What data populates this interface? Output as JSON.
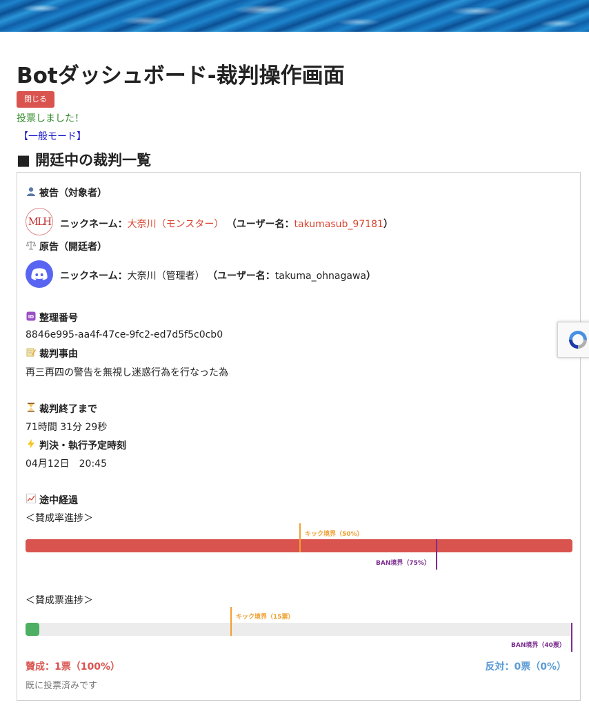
{
  "header": {
    "title": "Botダッシュボード-裁判操作画面"
  },
  "actions": {
    "close_label": "閉じる"
  },
  "status": {
    "vote_message": "投票しました！",
    "mode_label": "【一般モード】"
  },
  "section": {
    "title": "■ 開廷中の裁判一覧"
  },
  "trial": {
    "defendant": {
      "heading": "被告（対象者）",
      "avatar_text": "MLH",
      "nickname_label": "ニックネーム：",
      "nickname": "大奈川（モンスター）",
      "username_label": "（ユーザー名：",
      "username": "takumasub_97181",
      "username_close": "）"
    },
    "plaintiff": {
      "heading": "原告（開廷者）",
      "nickname_label": "ニックネーム：",
      "nickname": "大奈川（管理者）",
      "username_label": "（ユーザー名：",
      "username": "takuma_ohnagawa",
      "username_close": "）"
    },
    "id": {
      "heading": "整理番号",
      "value": "8846e995-aa4f-47ce-9fc2-ed7d5f5c0cb0"
    },
    "reason": {
      "heading": "裁判事由",
      "value": "再三再四の警告を無視し迷惑行為を行なった為"
    },
    "remaining": {
      "heading": "裁判終了まで",
      "value": "71時間 31分 29秒"
    },
    "verdict": {
      "heading": "判決・執行予定時刻",
      "value": "04月12日　20:45"
    },
    "progress": {
      "heading": "途中経過",
      "rate_title": "＜賛成率進捗＞",
      "rate": {
        "fill_fraction": 1.0,
        "kick_fraction": 0.5,
        "ban_fraction": 0.75,
        "kick_label": "キック境界（50%）",
        "ban_label": "BAN境界（75%）"
      },
      "votes_title": "＜賛成票進捗＞",
      "votes": {
        "fill_fraction": 0.025,
        "kick_fraction": 0.375,
        "ban_fraction": 1.0,
        "kick_label": "キック境界（15票）",
        "ban_label": "BAN境界（40票）"
      },
      "approve": "賛成：1票（100%）",
      "oppose": "反対：0票（0%）",
      "voted_note": "既に投票済みです"
    }
  },
  "colors": {
    "approve": "#d9534f",
    "votes_fill": "#4caf62",
    "track": "#ececec",
    "kick": "#f0a030",
    "ban": "#7b2d8e",
    "oppose": "#5b9bd5"
  },
  "icons": {
    "defendant": "person-icon",
    "plaintiff": "scales-icon",
    "id": "id-icon",
    "reason": "memo-icon",
    "remaining": "hourglass-icon",
    "verdict": "lightning-icon",
    "progress": "chart-icon"
  }
}
